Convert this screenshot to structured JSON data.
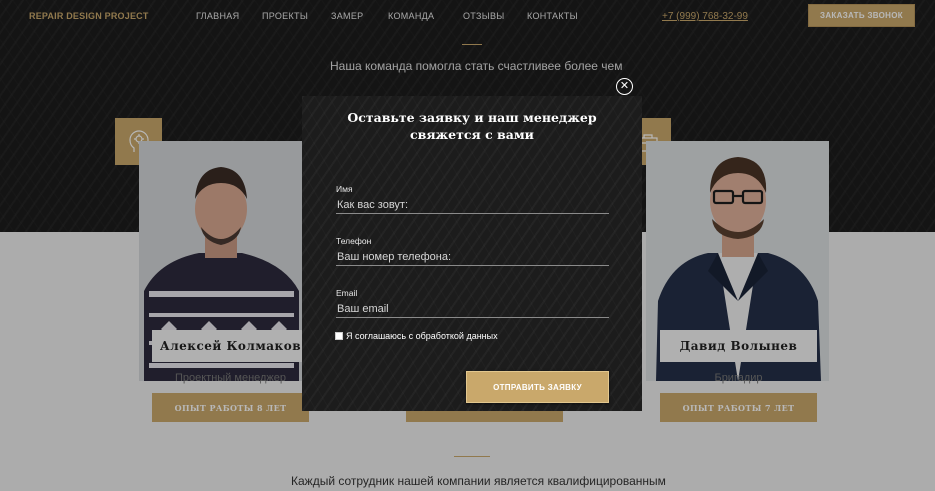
{
  "header": {
    "logo": "REPAIR DESIGN PROJECT",
    "nav": [
      "ГЛАВНАЯ",
      "ПРОЕКТЫ",
      "ЗАМЕР",
      "КОМАНДА",
      "ОТЗЫВЫ",
      "КОНТАКТЫ"
    ],
    "phone": "+7 (999) 768-32-99",
    "call_button": "ЗАКАЗАТЬ ЗВОНОК"
  },
  "team_section": {
    "intro": "Наша команда помогла стать счастливее более чем",
    "bottom_text": "Каждый сотрудник нашей компании является квалифицированным",
    "members": [
      {
        "name": "Алексей Колмаков",
        "role": "Проектный менеджер",
        "experience": "ОПЫТ РАБОТЫ 8 ЛЕТ",
        "badge_icon": "idea-head-icon"
      },
      {
        "name": "Давид Волынев",
        "role": "Бригадир",
        "experience": "ОПЫТ РАБОТЫ 7 ЛЕТ",
        "badge_icon": "toolbox-icon"
      }
    ]
  },
  "modal": {
    "title_line1": "Оставьте заявку и наш менеджер",
    "title_line2": "свяжется с вами",
    "fields": [
      {
        "label": "Имя",
        "placeholder": "Как вас зовут:"
      },
      {
        "label": "Телефон",
        "placeholder": "Ваш номер телефона:"
      },
      {
        "label": "Email",
        "placeholder": "Ваш email"
      }
    ],
    "consent": "Я соглашаюсь с обработкой данных",
    "submit": "ОТПРАВИТЬ ЗАЯВКУ",
    "close_icon": "close-icon"
  },
  "colors": {
    "accent": "#c9a86b",
    "dark": "#1d1d1d",
    "light": "#efefef"
  }
}
